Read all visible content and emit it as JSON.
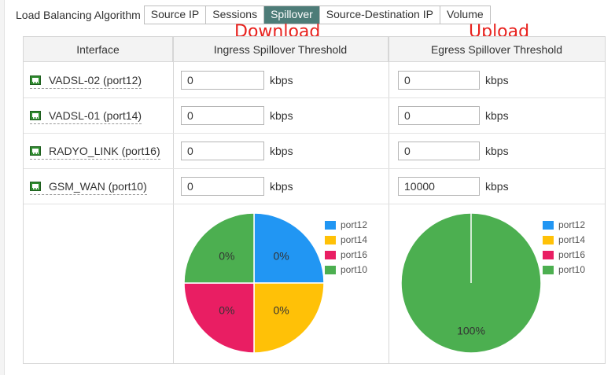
{
  "algorithm": {
    "label": "Load Balancing Algorithm",
    "options": [
      "Source IP",
      "Sessions",
      "Spillover",
      "Source-Destination IP",
      "Volume"
    ],
    "selected": "Spillover"
  },
  "annotations": {
    "download": "Download",
    "upload": "Upload"
  },
  "table": {
    "headers": {
      "interface": "Interface",
      "ingress": "Ingress Spillover Threshold",
      "egress": "Egress Spillover Threshold"
    },
    "unit": "kbps",
    "rows": [
      {
        "name": "VADSL-02 (port12)",
        "ingress": "0",
        "egress": "0"
      },
      {
        "name": "VADSL-01 (port14)",
        "ingress": "0",
        "egress": "0"
      },
      {
        "name": "RADYO_LINK (port16)",
        "ingress": "0",
        "egress": "0"
      },
      {
        "name": "GSM_WAN (port10)",
        "ingress": "0",
        "egress": "10000"
      }
    ]
  },
  "colors": {
    "accent": "#4d7c78",
    "annotation": "#e8211d",
    "port12": "#2196f3",
    "port14": "#ffc107",
    "port16": "#e91e63",
    "port10": "#4caf50"
  },
  "chart_data": [
    {
      "type": "pie",
      "title": "",
      "legend": [
        "port12",
        "port14",
        "port16",
        "port10"
      ],
      "legend_position": "right",
      "slices": [
        {
          "name": "port12",
          "value": 1,
          "label": "0%",
          "color": "#2196f3"
        },
        {
          "name": "port14",
          "value": 1,
          "label": "0%",
          "color": "#ffc107"
        },
        {
          "name": "port16",
          "value": 1,
          "label": "0%",
          "color": "#e91e63"
        },
        {
          "name": "port10",
          "value": 1,
          "label": "0%",
          "color": "#4caf50"
        }
      ]
    },
    {
      "type": "pie",
      "title": "",
      "legend": [
        "port12",
        "port14",
        "port16",
        "port10"
      ],
      "legend_position": "right",
      "slices": [
        {
          "name": "port12",
          "value": 0,
          "label": "",
          "color": "#2196f3"
        },
        {
          "name": "port14",
          "value": 0,
          "label": "",
          "color": "#ffc107"
        },
        {
          "name": "port16",
          "value": 0,
          "label": "",
          "color": "#e91e63"
        },
        {
          "name": "port10",
          "value": 100,
          "label": "100%",
          "color": "#4caf50"
        }
      ]
    }
  ]
}
